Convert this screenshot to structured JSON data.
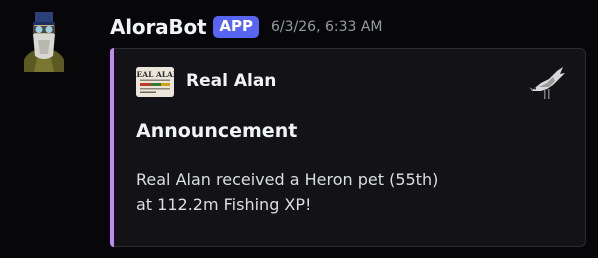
{
  "message": {
    "username": "AloraBot",
    "badge": "APP",
    "timestamp": "6/3/26, 6:33 AM",
    "avatar_icon": "wizard-avatar-icon"
  },
  "embed": {
    "accent_color": "#c38af0",
    "author_icon": "real-alan-server-logo",
    "author_icon_text": "REAL ALAN",
    "author_name": "Real Alan",
    "title": "Announcement",
    "description_lines": [
      "Real Alan received a Heron pet (55th)",
      "at 112.2m Fishing XP!"
    ],
    "thumbnail_icon": "heron-pet-icon"
  }
}
